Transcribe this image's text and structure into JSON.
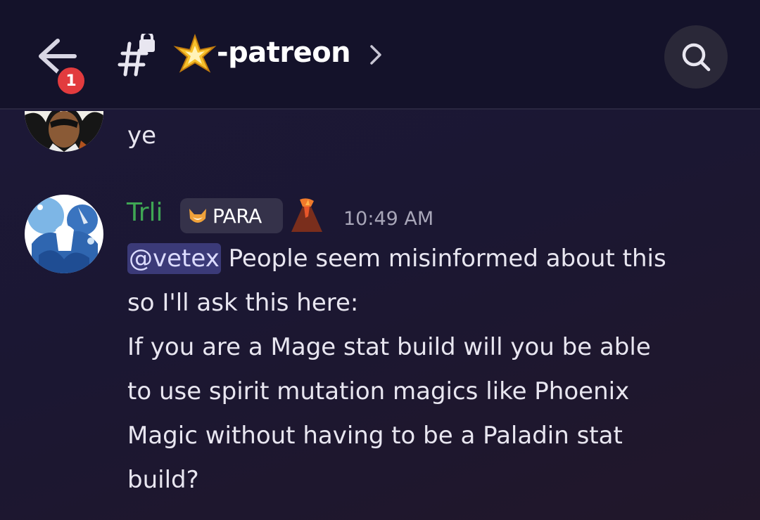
{
  "header": {
    "unread_count": "1",
    "channel_name": "-patreon",
    "channel_emoji": "sparkle-star",
    "channel_icon": "locked-hash-icon",
    "back_icon": "back-arrow-icon",
    "search_icon": "search-icon",
    "chevron_icon": "chevron-right-icon"
  },
  "messages": [
    {
      "text": "ye"
    },
    {
      "username": "Trli",
      "username_color": "#3fa654",
      "tag": "PARA",
      "timestamp": "10:49 AM",
      "mention": "@vetex",
      "lines": [
        " People seem misinformed about this",
        "so I'll ask this here:",
        "If you are a Mage stat build will you be able",
        "to use spirit mutation magics like Phoenix",
        "Magic without having to be a Paladin stat",
        "build?"
      ]
    }
  ],
  "colors": {
    "header_bg": "#14122a",
    "chat_bg": "#1c1838",
    "mention_bg": "#3b3a78",
    "badge": "#e23b3e"
  }
}
